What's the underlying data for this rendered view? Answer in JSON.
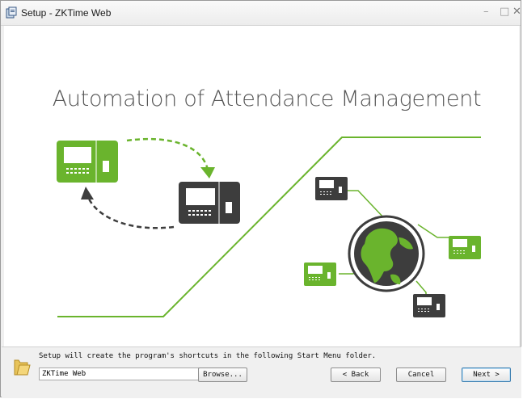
{
  "window": {
    "title": "Setup - ZKTime Web",
    "minimize": "–",
    "maximize": "□",
    "close": "✕"
  },
  "banner": {
    "headline": "Automation of Attendance Management",
    "icons": [
      "attendance-terminal-icon",
      "globe-icon"
    ],
    "colors": {
      "green": "#6ab42d",
      "dark": "#3d3d3d"
    }
  },
  "footer": {
    "hint": "Setup will create the program's shortcuts in the following Start Menu folder.",
    "folder_value": "ZKTime Web",
    "browse_label": "Browse...",
    "back_label": "< Back",
    "cancel_label": "Cancel",
    "next_label": "Next >"
  }
}
